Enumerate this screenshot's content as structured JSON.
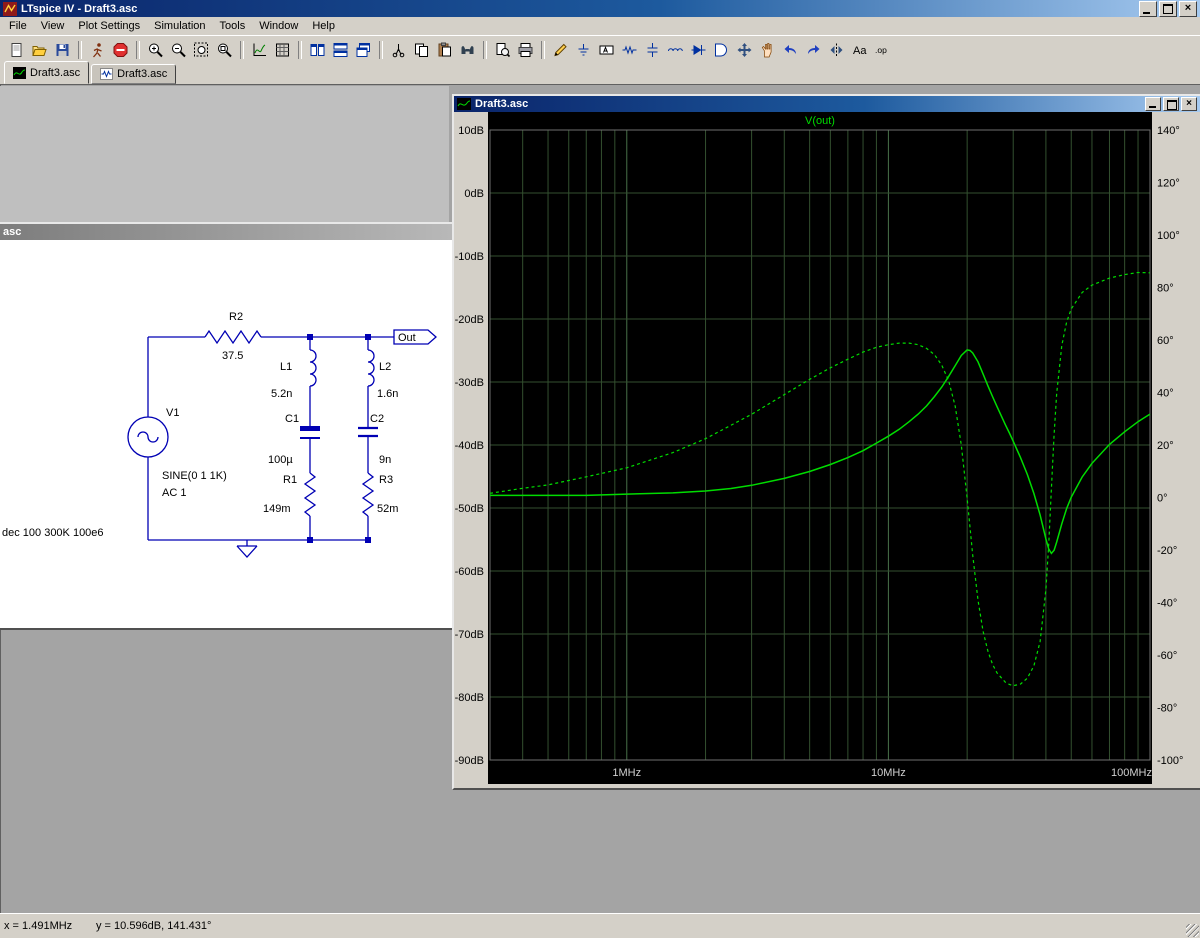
{
  "app": {
    "title": "LTspice IV - Draft3.asc"
  },
  "menu": {
    "items": [
      "File",
      "View",
      "Plot Settings",
      "Simulation",
      "Tools",
      "Window",
      "Help"
    ]
  },
  "toolbar": {
    "groups": [
      [
        "new-file",
        "open",
        "save"
      ],
      [
        "run",
        "halt"
      ],
      [
        "zoom-in",
        "zoom-out",
        "zoom-area",
        "zoom-full"
      ],
      [
        "autorange",
        "grid"
      ],
      [
        "tile-vertical",
        "tile-horizontal",
        "cascade"
      ],
      [
        "cut",
        "copy",
        "paste",
        "find"
      ],
      [
        "print-preview",
        "print"
      ],
      [
        "wire",
        "ground",
        "net-label",
        "resistor",
        "capacitor",
        "inductor",
        "diode",
        "component",
        "move",
        "drag",
        "undo",
        "redo",
        "mirror",
        "text",
        "spice-directive"
      ]
    ]
  },
  "tabs": [
    {
      "label": "Draft3.asc"
    },
    {
      "label": "Draft3.asc"
    }
  ],
  "schematic": {
    "window_title": "asc",
    "v1_name": "V1",
    "v1_value": "SINE(0 1 1K)",
    "v1_ac": "AC 1",
    "r2_name": "R2",
    "r2_value": "37.5",
    "l1_name": "L1",
    "l1_value": "5.2n",
    "c1_name": "C1",
    "c1_value": "100µ",
    "r1_name": "R1",
    "r1_value": "149m",
    "l2_name": "L2",
    "l2_value": "1.6n",
    "c2_name": "C2",
    "c2_value": "9n",
    "r3_name": "R3",
    "r3_value": "52m",
    "out_label": "Out",
    "directive": "dec 100 300K 100e6"
  },
  "plot_window": {
    "title": "Draft3.asc"
  },
  "chart_data": {
    "type": "line",
    "title": "V(out)",
    "x_axis": {
      "scale": "log",
      "unit": "MHz",
      "min": 0.3,
      "max": 100,
      "tick_values": [
        1,
        10,
        100
      ],
      "tick_labels": [
        "1MHz",
        "10MHz",
        "100MHz"
      ]
    },
    "y_left_axis": {
      "unit": "dB",
      "max": 10,
      "min": -90,
      "tick_values": [
        10,
        0,
        -10,
        -20,
        -30,
        -40,
        -50,
        -60,
        -70,
        -80,
        -90
      ],
      "tick_labels": [
        "10dB",
        "0dB",
        "-10dB",
        "-20dB",
        "-30dB",
        "-40dB",
        "-50dB",
        "-60dB",
        "-70dB",
        "-80dB",
        "-90dB"
      ]
    },
    "y_right_axis": {
      "unit": "deg",
      "max": 140,
      "min": -100,
      "tick_values": [
        140,
        120,
        100,
        80,
        60,
        40,
        20,
        0,
        -20,
        -40,
        -60,
        -80,
        -100
      ],
      "tick_labels": [
        "140°",
        "120°",
        "100°",
        "80°",
        "60°",
        "40°",
        "20°",
        "0°",
        "-20°",
        "-40°",
        "-60°",
        "-80°",
        "-100°"
      ]
    },
    "background": "#000000",
    "grid_color": "#33502f",
    "grid_major_color": "#49724a",
    "trace_color": "#00dc00",
    "legend_position": "top-center",
    "series": [
      {
        "name": "V(out) magnitude",
        "axis": "left",
        "style": "solid",
        "x_MHz": [
          0.3,
          0.4,
          0.5,
          0.7,
          1,
          1.5,
          2,
          2.5,
          3,
          4,
          5,
          6,
          7,
          8,
          9,
          10,
          11,
          12,
          13,
          14,
          15,
          16,
          17,
          18,
          19,
          20,
          20.5,
          21,
          22,
          23,
          24,
          25,
          26,
          28,
          29,
          30,
          32,
          34,
          36,
          38,
          40,
          41,
          42,
          43,
          44,
          46,
          48,
          50,
          55,
          60,
          70,
          80,
          90,
          100
        ],
        "y_dB": [
          -48,
          -48,
          -48,
          -48,
          -47.8,
          -47.6,
          -47.3,
          -46.9,
          -46.4,
          -45.3,
          -44.2,
          -43.1,
          -42,
          -40.9,
          -39.7,
          -38.6,
          -37.5,
          -36.3,
          -35.1,
          -33.8,
          -32.3,
          -30.8,
          -29.1,
          -27.4,
          -25.8,
          -24.9,
          -25,
          -25.4,
          -26.8,
          -28.7,
          -30.6,
          -32.3,
          -33.9,
          -36.8,
          -38.1,
          -39.4,
          -42,
          -44.7,
          -47.7,
          -51.1,
          -54.9,
          -56.5,
          -57.2,
          -56.7,
          -55.4,
          -52.5,
          -50.1,
          -48.3,
          -45.1,
          -42.9,
          -39.9,
          -37.9,
          -36.3,
          -35.1
        ]
      },
      {
        "name": "V(out) phase",
        "axis": "right",
        "style": "dashed",
        "x_MHz": [
          0.3,
          0.4,
          0.5,
          0.7,
          1,
          1.5,
          2,
          2.5,
          3,
          4,
          5,
          6,
          7,
          8,
          9,
          10,
          11,
          12,
          13,
          14,
          15,
          16,
          17,
          18,
          19,
          20,
          20.5,
          21,
          22,
          23,
          24,
          25,
          26,
          28,
          29,
          30,
          32,
          34,
          36,
          38,
          40,
          41,
          42,
          43,
          44,
          46,
          48,
          50,
          55,
          60,
          70,
          80,
          90,
          100
        ],
        "y_deg": [
          1.6,
          3.5,
          4.8,
          7.9,
          11.3,
          17.1,
          22.4,
          27.5,
          31.7,
          39.2,
          45,
          49.4,
          52.7,
          55.4,
          57.2,
          58.2,
          58.8,
          58.8,
          58.2,
          56.8,
          54.4,
          50.4,
          44.4,
          34.8,
          20,
          -0.1,
          -11.3,
          -21.9,
          -39.1,
          -50.8,
          -58.5,
          -63.5,
          -66.8,
          -70.4,
          -71.2,
          -71.7,
          -71.1,
          -68.8,
          -64.1,
          -54.9,
          -35,
          -18,
          3.4,
          24,
          39.7,
          57.9,
          66.8,
          71.8,
          78.1,
          80.9,
          83.6,
          84.9,
          85.7,
          85.6
        ]
      }
    ]
  },
  "status": {
    "x_readout": "x = 1.491MHz",
    "y_readout": "y = 10.596dB, 141.431°"
  }
}
